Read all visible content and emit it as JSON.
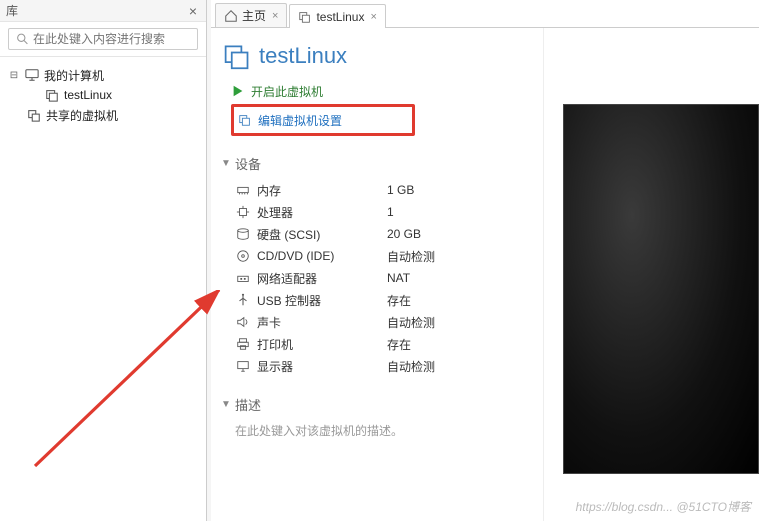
{
  "sidebar": {
    "title": "库",
    "search_placeholder": "在此处键入内容进行搜索",
    "tree": {
      "root": "我的计算机",
      "vm": "testLinux",
      "shared": "共享的虚拟机"
    }
  },
  "tabs": {
    "home": "主页",
    "vm": "testLinux"
  },
  "vm": {
    "title": "testLinux",
    "actions": {
      "power_on": "开启此虚拟机",
      "edit_settings": "编辑虚拟机设置"
    },
    "sections": {
      "devices": "设备",
      "description": "描述"
    },
    "devices": [
      {
        "icon": "memory-icon",
        "name": "内存",
        "value": "1 GB"
      },
      {
        "icon": "cpu-icon",
        "name": "处理器",
        "value": "1"
      },
      {
        "icon": "disk-icon",
        "name": "硬盘 (SCSI)",
        "value": "20 GB"
      },
      {
        "icon": "cd-icon",
        "name": "CD/DVD (IDE)",
        "value": "自动检测"
      },
      {
        "icon": "network-icon",
        "name": "网络适配器",
        "value": "NAT"
      },
      {
        "icon": "usb-icon",
        "name": "USB 控制器",
        "value": "存在"
      },
      {
        "icon": "sound-icon",
        "name": "声卡",
        "value": "自动检测"
      },
      {
        "icon": "printer-icon",
        "name": "打印机",
        "value": "存在"
      },
      {
        "icon": "display-icon",
        "name": "显示器",
        "value": "自动检测"
      }
    ],
    "description_placeholder": "在此处键入对该虚拟机的描述。"
  },
  "watermark": "https://blog.csdn... @51CTO博客"
}
